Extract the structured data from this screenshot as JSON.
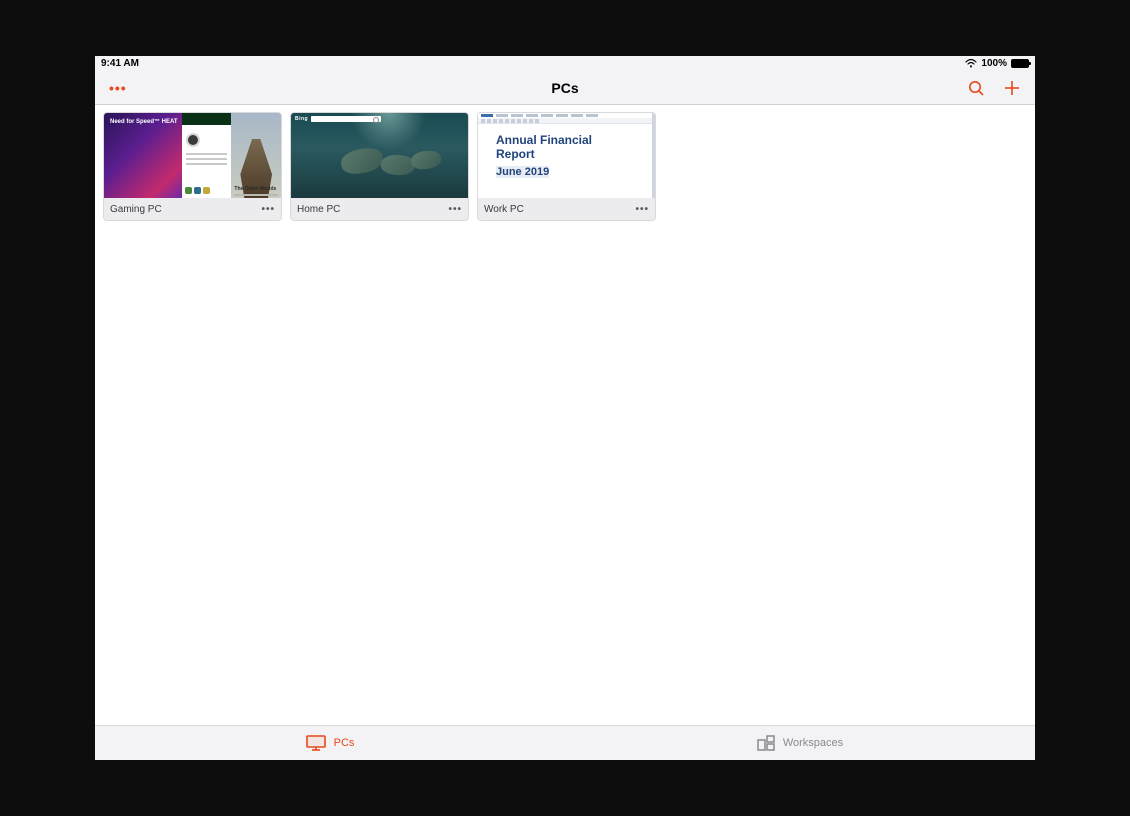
{
  "status": {
    "time": "9:41 AM",
    "battery_pct": "100%"
  },
  "nav": {
    "title": "PCs"
  },
  "pcs": [
    {
      "name": "Gaming PC",
      "thumb": {
        "kind": "store",
        "hero_title": "Need for Speed™ HEAT",
        "side_title": "The Outer Worlds"
      }
    },
    {
      "name": "Home PC",
      "thumb": {
        "kind": "bing",
        "logo": "Bing"
      }
    },
    {
      "name": "Work PC",
      "thumb": {
        "kind": "doc",
        "title_line1": "Annual Financial",
        "title_line2": "Report",
        "subtitle": "June 2019"
      }
    }
  ],
  "tabs": {
    "pcs": "PCs",
    "workspaces": "Workspaces"
  }
}
